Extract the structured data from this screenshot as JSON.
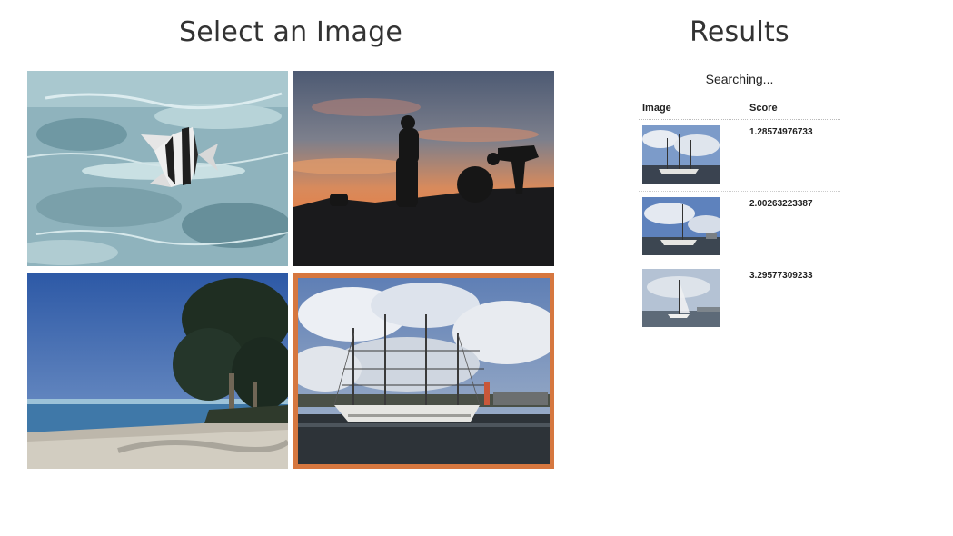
{
  "gallery": {
    "title": "Select an Image",
    "images": [
      {
        "subject": "underwater-fish",
        "selected": false
      },
      {
        "subject": "sunset-silhouettes",
        "selected": false
      },
      {
        "subject": "tropical-beach",
        "selected": false
      },
      {
        "subject": "tall-ship-harbor",
        "selected": true
      }
    ],
    "selected_border_color": "#d6773f"
  },
  "results": {
    "title": "Results",
    "status": "Searching...",
    "columns": {
      "image": "Image",
      "score": "Score"
    },
    "rows": [
      {
        "thumb": "sailing-ship-1",
        "score": "1.28574976733"
      },
      {
        "thumb": "sailing-ship-2",
        "score": "2.00263223387"
      },
      {
        "thumb": "sailboat",
        "score": "3.29577309233"
      }
    ]
  }
}
